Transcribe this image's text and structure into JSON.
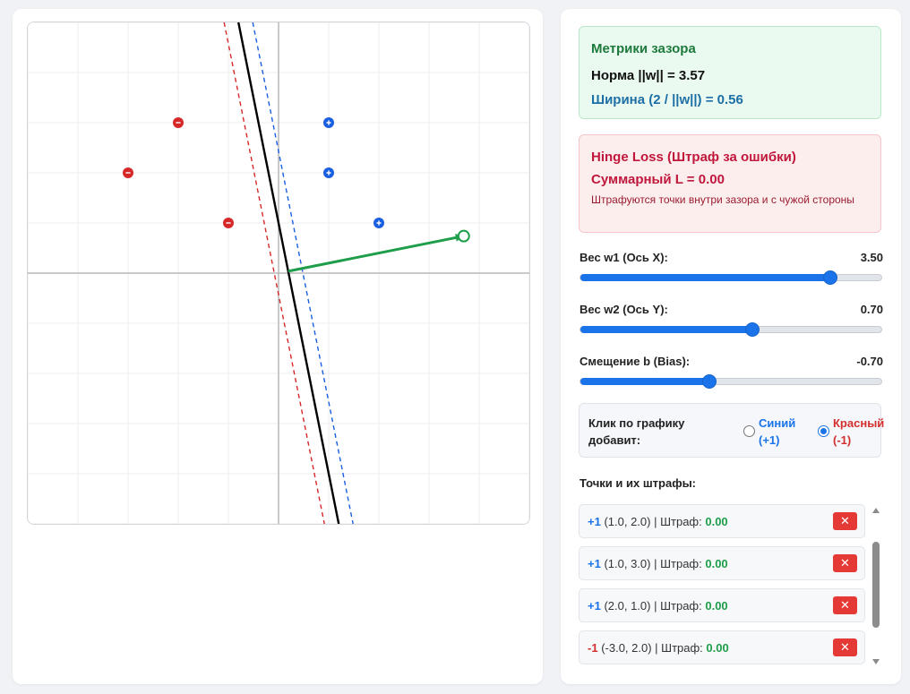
{
  "plot": {
    "xlim": [
      -5,
      5
    ],
    "ylim": [
      -5,
      5
    ],
    "grid": true,
    "weights": {
      "w1": 3.5,
      "w2": 0.7,
      "b": -0.7
    },
    "points": [
      {
        "label": 1,
        "x": 1.0,
        "y": 2.0
      },
      {
        "label": 1,
        "x": 1.0,
        "y": 3.0
      },
      {
        "label": 1,
        "x": 2.0,
        "y": 1.0
      },
      {
        "label": -1,
        "x": -3.0,
        "y": 2.0
      },
      {
        "label": -1,
        "x": -2.0,
        "y": 3.0
      },
      {
        "label": -1,
        "x": -1.0,
        "y": 1.0
      }
    ],
    "colors": {
      "positive": "#1a5fe0",
      "negative": "#d62828",
      "decision": "#000000",
      "weight_vector": "#1e9e4a",
      "grid": "#ececec",
      "axis": "#b8b8b8"
    }
  },
  "margin": {
    "title": "Метрики зазора",
    "norm_text": "Норма ||w|| = 3.57",
    "width_text": "Ширина (2 / ||w||) = 0.56"
  },
  "hinge": {
    "title": "Hinge Loss (Штраф за ошибки)",
    "total_text": "Суммарный L = 0.00",
    "note": "Штрафуются точки внутри зазора и с чужой стороны"
  },
  "sliders": [
    {
      "label": "Вес w1 (Ось X):",
      "value_text": "3.50",
      "fraction": 0.83
    },
    {
      "label": "Вес w2 (Ось Y):",
      "value_text": "0.70",
      "fraction": 0.57
    },
    {
      "label": "Смещение b (Bias):",
      "value_text": "-0.70",
      "fraction": 0.43
    }
  ],
  "mode": {
    "label": "Клик по графику добавит:",
    "options": [
      {
        "text": "Синий (+1)",
        "checked": false
      },
      {
        "text": "Красный (-1)",
        "checked": true
      }
    ]
  },
  "points_heading": "Точки и их штрафы:",
  "points_list": [
    {
      "label_text": "+1",
      "coords": "(1.0, 2.0)",
      "penalty_label": "Штраф:",
      "penalty": "0.00",
      "delete": "✕"
    },
    {
      "label_text": "+1",
      "coords": "(1.0, 3.0)",
      "penalty_label": "Штраф:",
      "penalty": "0.00",
      "delete": "✕"
    },
    {
      "label_text": "+1",
      "coords": "(2.0, 1.0)",
      "penalty_label": "Штраф:",
      "penalty": "0.00",
      "delete": "✕"
    },
    {
      "label_text": "-1",
      "coords": "(-3.0, 2.0)",
      "penalty_label": "Штраф:",
      "penalty": "0.00",
      "delete": "✕"
    }
  ]
}
